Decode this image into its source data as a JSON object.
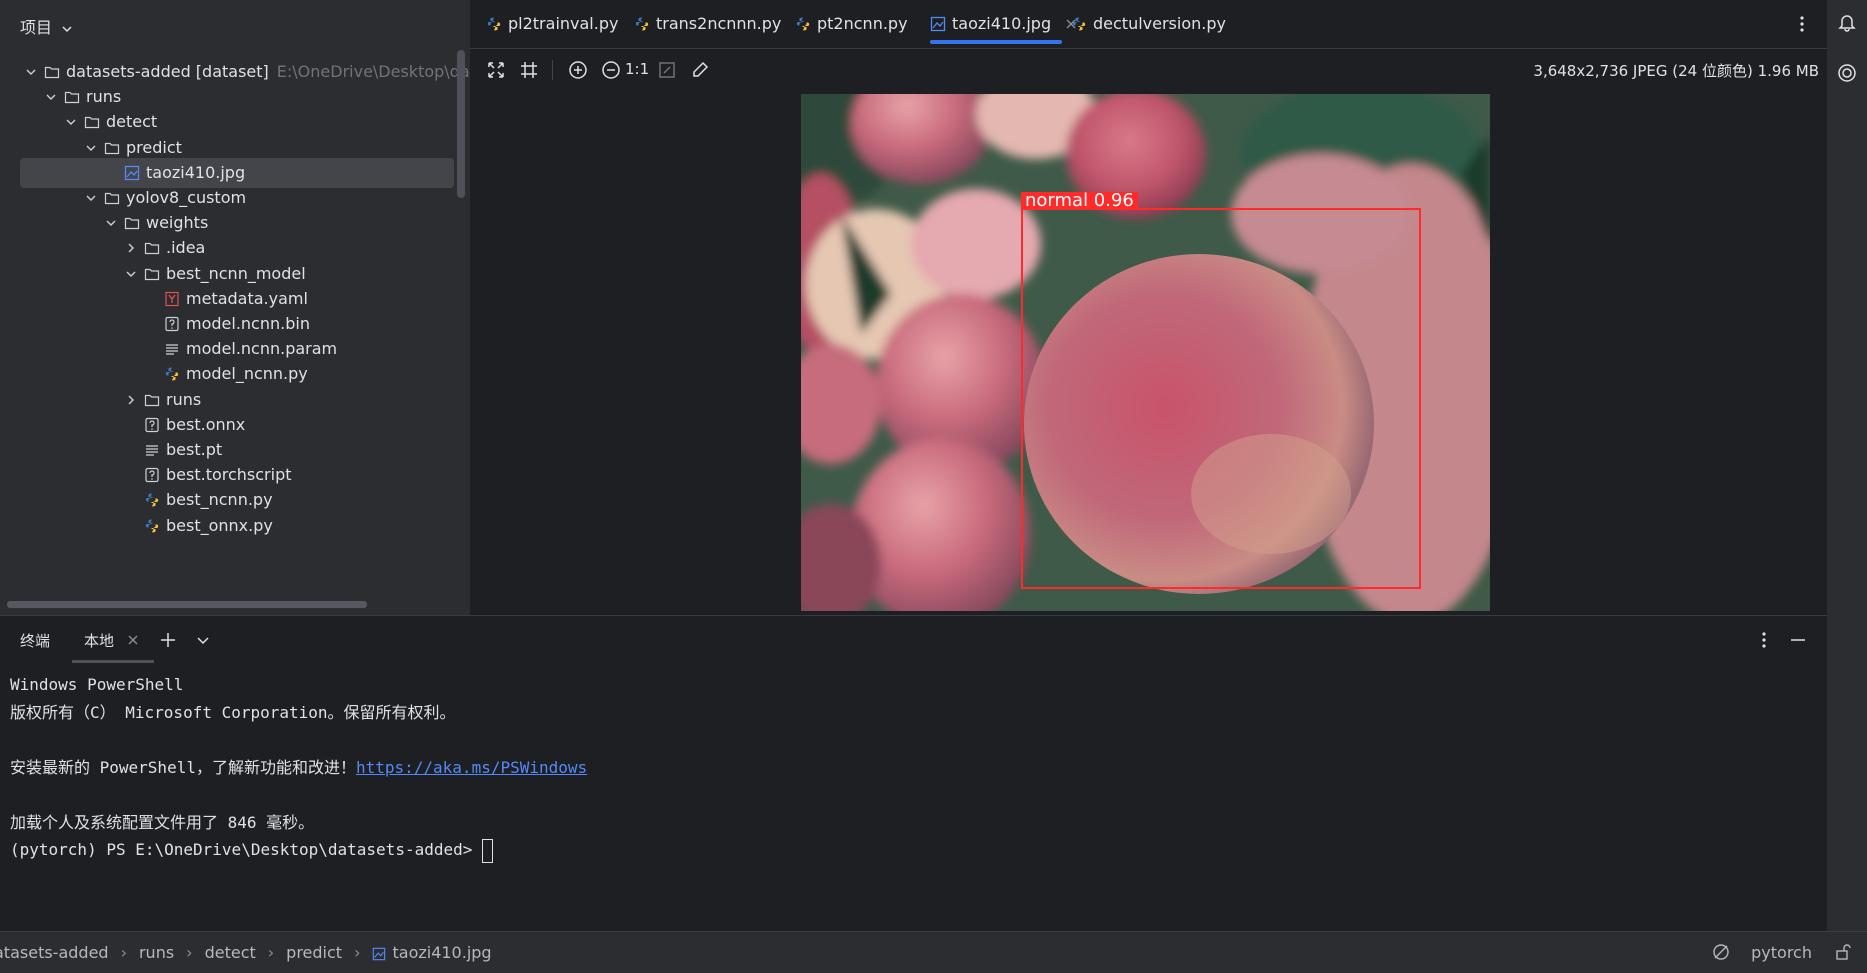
{
  "project": {
    "title": "项目",
    "tree": [
      {
        "label": "datasets-added [dataset]",
        "path": "E:\\OneDrive\\Desktop\\datase",
        "icon": "folder-icon",
        "expanded": true
      },
      {
        "label": "runs",
        "icon": "folder-icon",
        "expanded": true
      },
      {
        "label": "detect",
        "icon": "folder-icon",
        "expanded": true
      },
      {
        "label": "predict",
        "icon": "folder-icon",
        "expanded": true
      },
      {
        "label": "taozi410.jpg",
        "icon": "image-file-icon",
        "selected": true
      },
      {
        "label": "yolov8_custom",
        "icon": "folder-icon",
        "expanded": true
      },
      {
        "label": "weights",
        "icon": "folder-icon",
        "expanded": true
      },
      {
        "label": ".idea",
        "icon": "folder-icon",
        "expanded": false
      },
      {
        "label": "best_ncnn_model",
        "icon": "folder-icon",
        "expanded": true
      },
      {
        "label": "metadata.yaml",
        "icon": "yaml-file-icon"
      },
      {
        "label": "model.ncnn.bin",
        "icon": "unknown-file-icon"
      },
      {
        "label": "model.ncnn.param",
        "icon": "text-file-icon"
      },
      {
        "label": "model_ncnn.py",
        "icon": "python-file-icon"
      },
      {
        "label": "runs",
        "icon": "folder-icon",
        "expanded": false
      },
      {
        "label": "best.onnx",
        "icon": "unknown-file-icon"
      },
      {
        "label": "best.pt",
        "icon": "text-file-icon"
      },
      {
        "label": "best.torchscript",
        "icon": "unknown-file-icon"
      },
      {
        "label": "best_ncnn.py",
        "icon": "python-file-icon"
      },
      {
        "label": "best_onnx.py",
        "icon": "python-file-icon"
      }
    ]
  },
  "tabs": [
    {
      "label": "pl2trainval.py",
      "icon": "python-file-icon"
    },
    {
      "label": "trans2ncnnn.py",
      "icon": "python-file-icon"
    },
    {
      "label": "pt2ncnn.py",
      "icon": "python-file-icon"
    },
    {
      "label": "taozi410.jpg",
      "icon": "image-file-icon",
      "active": true
    },
    {
      "label": "dectulversion.py",
      "icon": "python-file-icon"
    }
  ],
  "image_toolbar": {
    "actual_size_label": "1:1",
    "info": "3,648x2,736 JPEG (24 位颜色) 1.96 MB"
  },
  "detection": {
    "label": "normal  0.96",
    "color": "#ff2a2a"
  },
  "terminal": {
    "title": "终端",
    "tab_label": "本地",
    "lines": {
      "l1": "Windows PowerShell",
      "l2": "版权所有（C） Microsoft Corporation。保留所有权利。",
      "l4_prefix": "安装最新的 PowerShell，了解新功能和改进！",
      "l4_link": "https://aka.ms/PSWindows",
      "l6": "加载个人及系统配置文件用了 846 毫秒。",
      "l7": "(pytorch) PS E:\\OneDrive\\Desktop\\datasets-added>"
    }
  },
  "statusbar": {
    "breadcrumb": [
      "atasets-added",
      "runs",
      "detect",
      "predict",
      "taozi410.jpg"
    ],
    "env": "pytorch"
  },
  "colors": {
    "accent": "#3574f0",
    "link": "#548af7",
    "python_blue": "#3d7ab8",
    "python_yellow": "#f5c23c"
  }
}
